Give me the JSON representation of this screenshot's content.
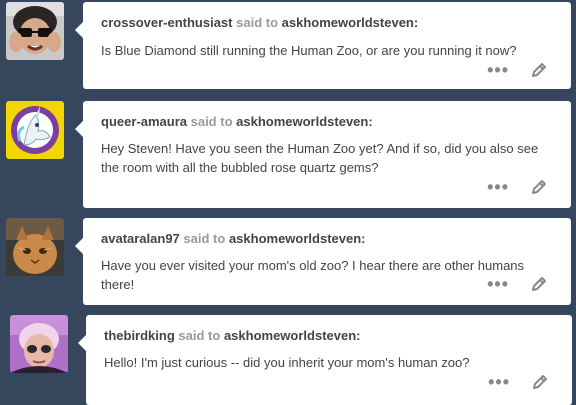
{
  "said_label": "said to",
  "recipient": "askhomeworldsteven:",
  "icons": {
    "more": "more-dots-icon",
    "edit": "pencil-icon"
  },
  "more_glyph": "•••",
  "colors": {
    "background": "#36465d",
    "card": "#ffffff",
    "username": "#444444",
    "muted": "#999999"
  },
  "posts": [
    {
      "username": "crossover-enthusiast",
      "question": "Is Blue Diamond still running the Human Zoo, or are you running it now?"
    },
    {
      "username": "queer-amaura",
      "question": "Hey Steven! Have you seen the Human Zoo yet? And if so, did you also see the room with all the bubbled rose quartz gems?"
    },
    {
      "username": "avataralan97",
      "question": "Have you ever visited your mom's old zoo? I hear there are other humans there!"
    },
    {
      "username": "thebirdking",
      "question": "Hello! I'm just curious -- did you inherit your mom's human zoo?"
    }
  ]
}
